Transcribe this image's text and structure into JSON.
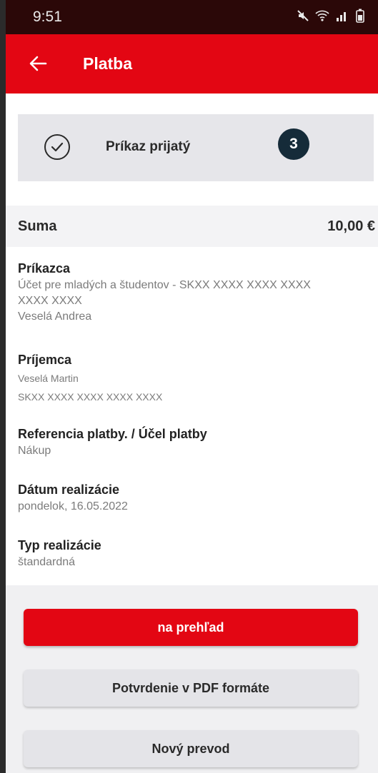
{
  "status_bar": {
    "time": "9:51"
  },
  "app_bar": {
    "title": "Platba"
  },
  "status_card": {
    "text": "Príkaz prijatý",
    "badge": "3"
  },
  "summary": {
    "label": "Suma",
    "value": "10,00 €"
  },
  "details": {
    "payer": {
      "heading": "Príkazca",
      "account_line": "Účet pre mladých a študentov - SKXX XXXX XXXX XXXX",
      "account_line2": "XXXX XXXX",
      "name": "Veselá Andrea"
    },
    "recipient": {
      "heading": "Príjemca",
      "name": "Veselá Martin",
      "iban": "SKXX XXXX XXXX XXXX XXXX"
    },
    "reference": {
      "heading": "Referencia platby. / Účel platby",
      "value": "Nákup"
    },
    "date": {
      "heading": "Dátum realizácie",
      "value": "pondelok, 16.05.2022"
    },
    "type": {
      "heading": "Typ realizácie",
      "value": "štandardná"
    }
  },
  "buttons": {
    "overview": "na prehľad",
    "pdf": "Potvrdenie v PDF formáte",
    "new_transfer": "Nový prevod"
  },
  "colors": {
    "brand_red": "#e30613",
    "badge": "#152b39",
    "status_bar": "#2b0808"
  }
}
